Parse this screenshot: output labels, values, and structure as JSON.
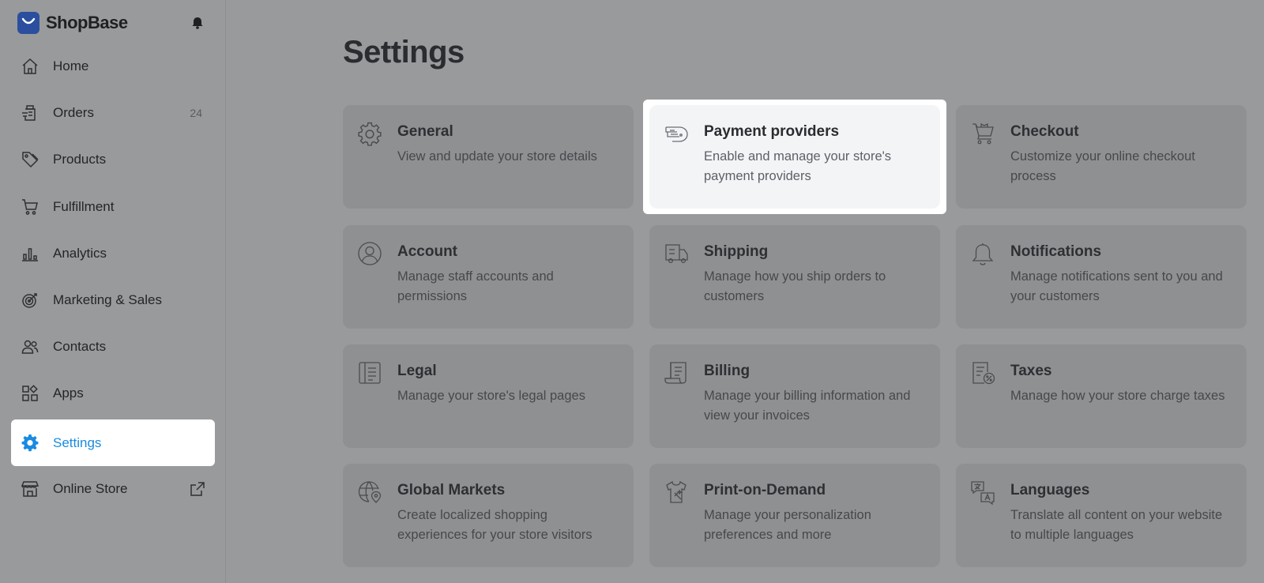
{
  "brand": {
    "name": "ShopBase"
  },
  "sidebar": {
    "items": [
      {
        "label": "Home",
        "icon": "home-icon"
      },
      {
        "label": "Orders",
        "icon": "orders-icon",
        "count": "24"
      },
      {
        "label": "Products",
        "icon": "tag-icon"
      },
      {
        "label": "Fulfillment",
        "icon": "cart-icon"
      },
      {
        "label": "Analytics",
        "icon": "bar-chart-icon"
      },
      {
        "label": "Marketing & Sales",
        "icon": "target-icon"
      },
      {
        "label": "Contacts",
        "icon": "users-icon"
      },
      {
        "label": "Apps",
        "icon": "apps-grid-icon"
      },
      {
        "label": "Settings",
        "icon": "gear-icon",
        "active": true
      },
      {
        "label": "Online Store",
        "icon": "store-icon",
        "external_icon": "external-link-icon"
      }
    ]
  },
  "page": {
    "title": "Settings"
  },
  "cards": [
    {
      "title": "General",
      "desc": "View and update your store details",
      "icon": "gear-icon"
    },
    {
      "title": "Payment providers",
      "desc": "Enable and manage your store's payment providers",
      "icon": "payment-icon",
      "highlighted": true
    },
    {
      "title": "Checkout",
      "desc": "Customize your online checkout process",
      "icon": "cart-icon"
    },
    {
      "title": "Account",
      "desc": "Manage staff accounts and permissions",
      "icon": "user-circle-icon"
    },
    {
      "title": "Shipping",
      "desc": "Manage how you ship orders to customers",
      "icon": "truck-icon"
    },
    {
      "title": "Notifications",
      "desc": "Manage notifications sent to you and your customers",
      "icon": "bell-icon"
    },
    {
      "title": "Legal",
      "desc": "Manage your store's legal pages",
      "icon": "legal-document-icon"
    },
    {
      "title": "Billing",
      "desc": "Manage your billing information and view your invoices",
      "icon": "receipt-icon"
    },
    {
      "title": "Taxes",
      "desc": "Manage how your store charge taxes",
      "icon": "tax-icon"
    },
    {
      "title": "Global Markets",
      "desc": "Create localized shopping experiences for your store visitors",
      "icon": "globe-pin-icon"
    },
    {
      "title": "Print-on-Demand",
      "desc": "Manage your personalization preferences and more",
      "icon": "shirt-icon"
    },
    {
      "title": "Languages",
      "desc": "Translate all content on your website to multiple languages",
      "icon": "translate-icon"
    }
  ],
  "colors": {
    "accent": "#1a8be0",
    "brand": "#2b4f9e",
    "overlay": "#999a9b",
    "card_highlight": "#f3f4f6"
  }
}
